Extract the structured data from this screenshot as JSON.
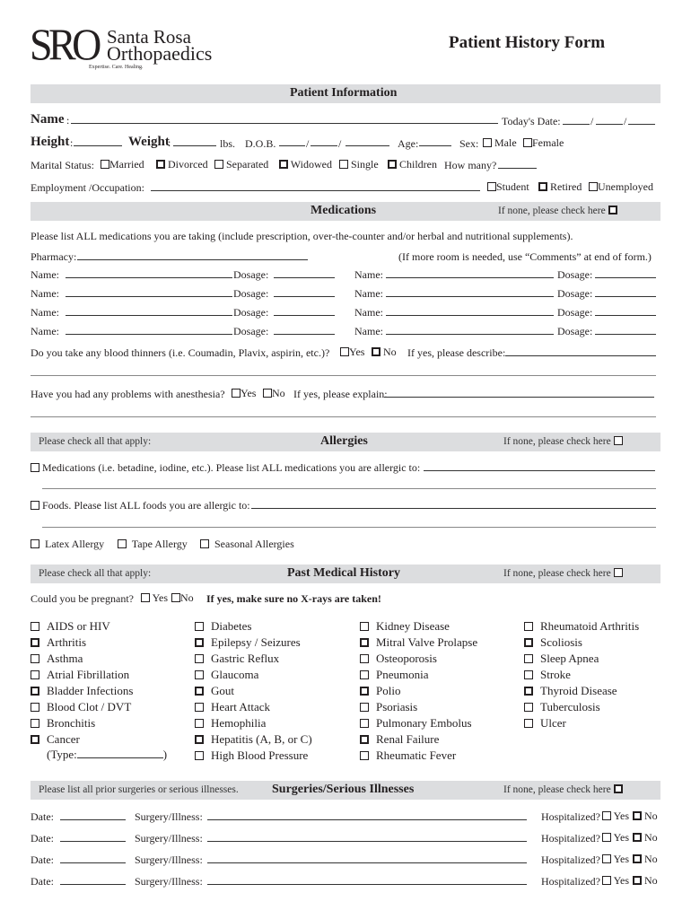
{
  "header": {
    "logo_mark": "SRO",
    "logo_name_line1": "Santa Rosa",
    "logo_name_line2": "Orthopaedics",
    "logo_tagline": "Expertise. Care. Healing.",
    "form_title": "Patient History Form"
  },
  "patient_info": {
    "section_title": "Patient Information",
    "name_label": "Name",
    "todays_date_label": "Today's Date:",
    "height_label": "Height",
    "weight_label": "Weight",
    "lbs": "lbs.",
    "dob_label": "D.O.B.",
    "age_label": "Age:",
    "sex_label": "Sex:",
    "sex_options": [
      "Male",
      "Female"
    ],
    "marital_label": "Marital Status:",
    "marital_options": [
      "Married",
      "Divorced",
      "Separated",
      "Widowed",
      "Single",
      "Children"
    ],
    "how_many_label": "How many?",
    "employment_label": "Employment /Occupation:",
    "employment_options": [
      "Student",
      "Retired",
      "Unemployed"
    ]
  },
  "medications": {
    "section_title": "Medications",
    "none_label": "If none, please check here",
    "instructions": "Please list ALL medications you are taking (include prescription, over-the-counter and/or herbal and nutritional supplements).",
    "pharmacy_label": "Pharmacy:",
    "more_room_note": "(If more room is needed, use “Comments” at end of form.)",
    "name_label": "Name:",
    "dosage_label": "Dosage:",
    "blood_thinners_q": "Do you take any blood thinners (i.e. Coumadin, Plavix, aspirin, etc.)?",
    "yes": "Yes",
    "no": "No",
    "describe_label": "If yes, please describe:",
    "anesthesia_q": "Have you had any problems with anesthesia?",
    "explain_label": "If yes, please explain:"
  },
  "allergies": {
    "section_title": "Allergies",
    "check_all": "Please check all that apply:",
    "none_label": "If none, please check here",
    "medications_label": "Medications (i.e. betadine, iodine, etc.). Please list ALL medications you are allergic to:",
    "foods_label": "Foods. Please list ALL foods you are allergic to:",
    "other_options": [
      "Latex Allergy",
      "Tape Allergy",
      "Seasonal Allergies"
    ]
  },
  "pmh": {
    "section_title": "Past Medical History",
    "check_all": "Please check all that apply:",
    "none_label": "If none, please check here",
    "pregnant_q": "Could you be pregnant?",
    "yes": "Yes",
    "no": "No",
    "xray_warning": "If yes, make sure no X-rays are taken!",
    "col1": [
      "AIDS or HIV",
      "Arthritis",
      "Asthma",
      "Atrial Fibrillation",
      "Bladder Infections",
      "Blood Clot / DVT",
      "Bronchitis",
      "Cancer"
    ],
    "cancer_type_label": "(Type:",
    "cancer_type_close": ")",
    "col2": [
      "Diabetes",
      "Epilepsy / Seizures",
      "Gastric Reflux",
      "Glaucoma",
      "Gout",
      "Heart Attack",
      "Hemophilia",
      "Hepatitis (A, B, or C)",
      "High Blood Pressure"
    ],
    "col3": [
      "Kidney Disease",
      "Mitral Valve Prolapse",
      "Osteoporosis",
      "Pneumonia",
      "Polio",
      "Psoriasis",
      "Pulmonary Embolus",
      "Renal Failure",
      "Rheumatic Fever"
    ],
    "col4": [
      "Rheumatoid Arthritis",
      "Scoliosis",
      "Sleep Apnea",
      "Stroke",
      "Thyroid Disease",
      "Tuberculosis",
      "Ulcer"
    ]
  },
  "surgeries": {
    "section_title": "Surgeries/Serious Illnesses",
    "instructions": "Please list all prior surgeries or serious illnesses.",
    "none_label": "If none, please check here",
    "date_label": "Date:",
    "surgery_label": "Surgery/Illness:",
    "hospitalized_label": "Hospitalized?",
    "yes": "Yes",
    "no": "No"
  }
}
